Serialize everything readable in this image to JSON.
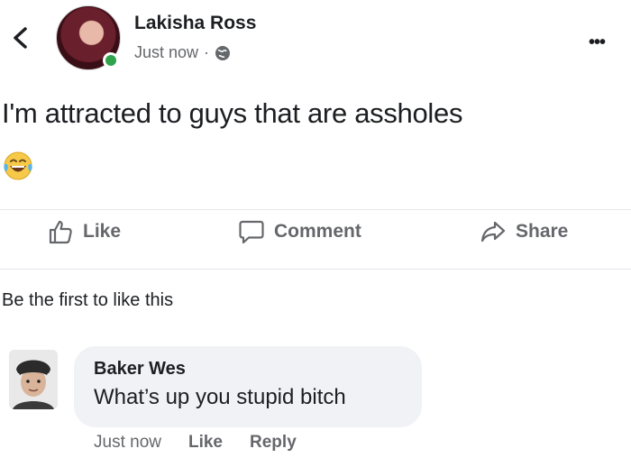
{
  "post": {
    "author": "Lakisha Ross",
    "time": "Just now",
    "separator": "·",
    "text": "I'm attracted to guys that are assholes",
    "emoji": "laughing-tears-emoji",
    "more_label": "•••"
  },
  "actions": {
    "like": "Like",
    "comment": "Comment",
    "share": "Share"
  },
  "likes_summary": "Be the first to like this",
  "comment": {
    "author": "Baker Wes",
    "text": "What’s up you stupid bitch",
    "time": "Just now",
    "like": "Like",
    "reply": "Reply"
  },
  "colors": {
    "text": "#1c1e21",
    "secondary": "#65676b",
    "bubble": "#f0f2f5",
    "online": "#31a24c"
  }
}
